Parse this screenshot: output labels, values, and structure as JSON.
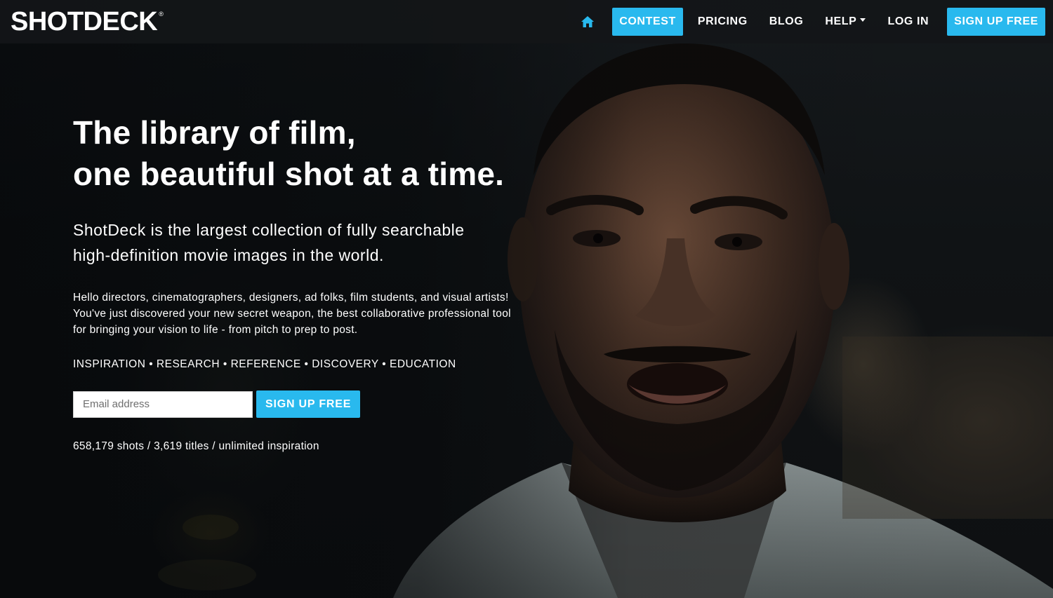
{
  "brand": {
    "logo_text": "SHOTDECK",
    "logo_mark": "®"
  },
  "nav": {
    "home_icon": "home-icon",
    "items": [
      {
        "label": "CONTEST"
      },
      {
        "label": "PRICING"
      },
      {
        "label": "BLOG"
      },
      {
        "label": "HELP"
      },
      {
        "label": "LOG IN"
      },
      {
        "label": "SIGN UP FREE"
      }
    ],
    "help_menu_icon": "caret-down-icon"
  },
  "hero": {
    "headline_line1": "The library of film,",
    "headline_line2": "one beautiful shot at a time.",
    "subhead_line1": "ShotDeck is the largest collection of fully searchable",
    "subhead_line2": "high-definition movie images in the world.",
    "intro": "Hello directors, cinematographers, designers, ad folks, film students, and visual artists! You've just discovered your new secret weapon, the best collaborative professional tool for bringing your vision to life - from pitch to prep to post.",
    "pillars": "INSPIRATION • RESEARCH • REFERENCE • DISCOVERY • EDUCATION",
    "email_placeholder": "Email address",
    "signup_label": "SIGN UP FREE",
    "stats": "658,179 shots / 3,619 titles / unlimited inspiration"
  },
  "colors": {
    "accent": "#29b9ee",
    "navbar_bg": "#141618",
    "text": "#ffffff"
  }
}
